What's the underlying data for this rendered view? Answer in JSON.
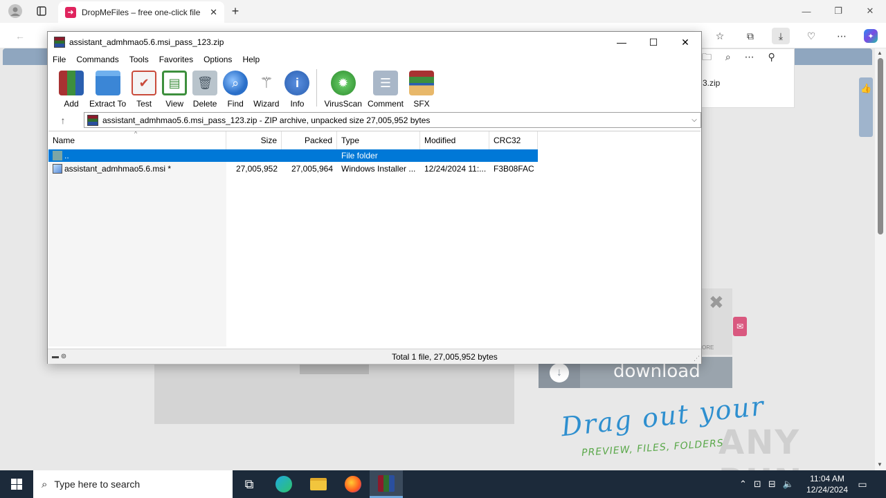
{
  "browser": {
    "tab_title": "DropMeFiles – free one-click file",
    "tab_close": "✕",
    "new_tab": "+",
    "partial_file": "3.zip"
  },
  "page": {
    "download_label": "download",
    "drag_text": "Drag out your",
    "drag_sub": "PREVIEW, FILES, FOLDERS",
    "ad_more": "ORE",
    "watermark": "ANY RUN"
  },
  "winrar": {
    "title": "assistant_admhmao5.6.msi_pass_123.zip",
    "menu": [
      "File",
      "Commands",
      "Tools",
      "Favorites",
      "Options",
      "Help"
    ],
    "tools": [
      {
        "label": "Add",
        "icon": "add-archive-icon",
        "color": "#a83232"
      },
      {
        "label": "Extract To",
        "icon": "extract-folder-icon",
        "color": "#3b86d6"
      },
      {
        "label": "Test",
        "icon": "test-checklist-icon",
        "color": "#c94a3a"
      },
      {
        "label": "View",
        "icon": "view-book-icon",
        "color": "#3d8f3d"
      },
      {
        "label": "Delete",
        "icon": "delete-trash-icon",
        "color": "#8a9aa8"
      },
      {
        "label": "Find",
        "icon": "find-magnifier-icon",
        "color": "#2a6fc9"
      },
      {
        "label": "Wizard",
        "icon": "wizard-wand-icon",
        "color": "#888888"
      },
      {
        "label": "Info",
        "icon": "info-icon",
        "color": "#2a5fb0"
      },
      {
        "label": "VirusScan",
        "icon": "virus-scan-icon",
        "color": "#3aa53a"
      },
      {
        "label": "Comment",
        "icon": "comment-icon",
        "color": "#8a9ab0"
      },
      {
        "label": "SFX",
        "icon": "sfx-box-icon",
        "color": "#d9a04a"
      }
    ],
    "address": "assistant_admhmao5.6.msi_pass_123.zip - ZIP archive, unpacked size 27,005,952 bytes",
    "columns": [
      "Name",
      "Size",
      "Packed",
      "Type",
      "Modified",
      "CRC32"
    ],
    "rows": [
      {
        "name": "..",
        "size": "",
        "packed": "",
        "type": "File folder",
        "modified": "",
        "crc": ""
      },
      {
        "name": "assistant_admhmao5.6.msi *",
        "size": "27,005,952",
        "packed": "27,005,964",
        "type": "Windows Installer ...",
        "modified": "12/24/2024 11:...",
        "crc": "F3B08FAC"
      }
    ],
    "status": "Total 1 file, 27,005,952 bytes"
  },
  "taskbar": {
    "search_placeholder": "Type here to search",
    "time": "11:04 AM",
    "date": "12/24/2024"
  }
}
